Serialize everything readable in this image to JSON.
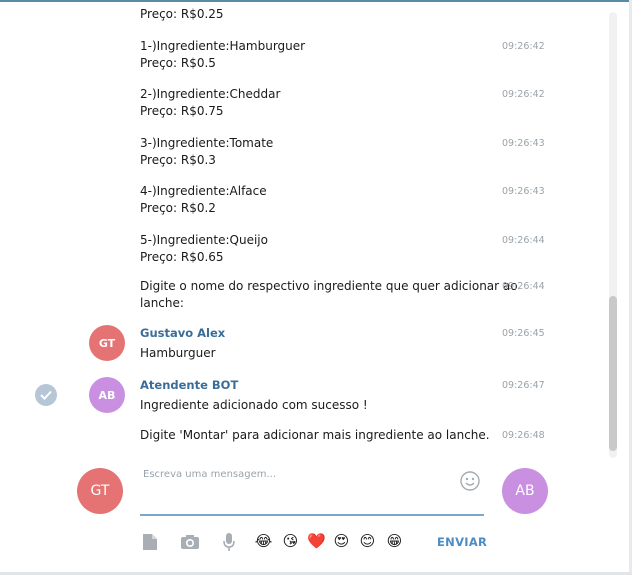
{
  "messages": [
    {
      "lines": [
        "Preço: R$0.25"
      ],
      "time": ""
    },
    {
      "lines": [
        "1-)Ingrediente:Hamburguer",
        "Preço: R$0.5"
      ],
      "time": "09:26:42"
    },
    {
      "lines": [
        "2-)Ingrediente:Cheddar",
        "Preço: R$0.75"
      ],
      "time": "09:26:42"
    },
    {
      "lines": [
        "3-)Ingrediente:Tomate",
        "Preço: R$0.3"
      ],
      "time": "09:26:43"
    },
    {
      "lines": [
        "4-)Ingrediente:Alface",
        "Preço: R$0.2"
      ],
      "time": "09:26:43"
    },
    {
      "lines": [
        "5-)Ingrediente:Queijo",
        "Preço: R$0.65"
      ],
      "time": "09:26:44"
    },
    {
      "lines": [
        "Digite o nome do respectivo ingrediente que quer adicionar ao",
        "lanche:"
      ],
      "time": "09:26:44"
    },
    {
      "sender": "Gustavo Alex",
      "avatar": "GT",
      "lines": [
        "Hamburguer"
      ],
      "time": "09:26:45"
    },
    {
      "sender": "Atendente BOT",
      "avatar": "AB",
      "lines": [
        "Ingrediente adicionado com sucesso !"
      ],
      "time": "09:26:47"
    },
    {
      "lines": [
        "Digite 'Montar' para adicionar mais ingrediente ao lanche."
      ],
      "time": "09:26:48"
    }
  ],
  "composer": {
    "placeholder": "Escreva uma mensagem...",
    "user_avatar": "GT",
    "peer_avatar": "AB",
    "send_label": "ENVIAR",
    "emojis": [
      "😂",
      "😘",
      "❤️",
      "😍",
      "😊",
      "😁"
    ]
  },
  "icons": {
    "read_status": "check-circle-icon",
    "attach": "document-icon",
    "camera": "camera-icon",
    "voice": "microphone-icon",
    "emoji_picker": "smiley-icon"
  },
  "colors": {
    "gt_avatar": "#e57373",
    "ab_avatar": "#c98fe0",
    "sender_name": "#3a6d99",
    "send_button": "#4b8cc2",
    "input_underline": "#78a7c9"
  }
}
